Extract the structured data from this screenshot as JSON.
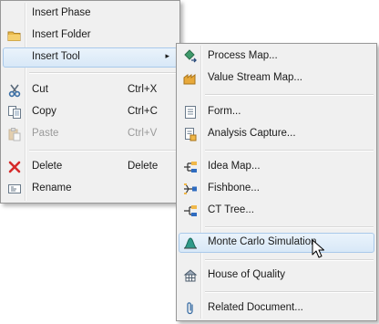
{
  "context_menu": {
    "insert_phase": "Insert Phase",
    "insert_folder": "Insert Folder",
    "insert_tool": "Insert Tool",
    "submenu_arrow": "▸",
    "cut": "Cut",
    "cut_shortcut": "Ctrl+X",
    "copy": "Copy",
    "copy_shortcut": "Ctrl+C",
    "paste": "Paste",
    "paste_shortcut": "Ctrl+V",
    "delete": "Delete",
    "delete_shortcut": "Delete",
    "rename": "Rename"
  },
  "tool_submenu": {
    "process_map": "Process Map...",
    "value_stream_map": "Value Stream Map...",
    "form": "Form...",
    "analysis_capture": "Analysis Capture...",
    "idea_map": "Idea Map...",
    "fishbone": "Fishbone...",
    "ct_tree": "CT Tree...",
    "monte_carlo": "Monte Carlo Simulation",
    "house_of_quality": "House of Quality",
    "related_document": "Related Document..."
  }
}
